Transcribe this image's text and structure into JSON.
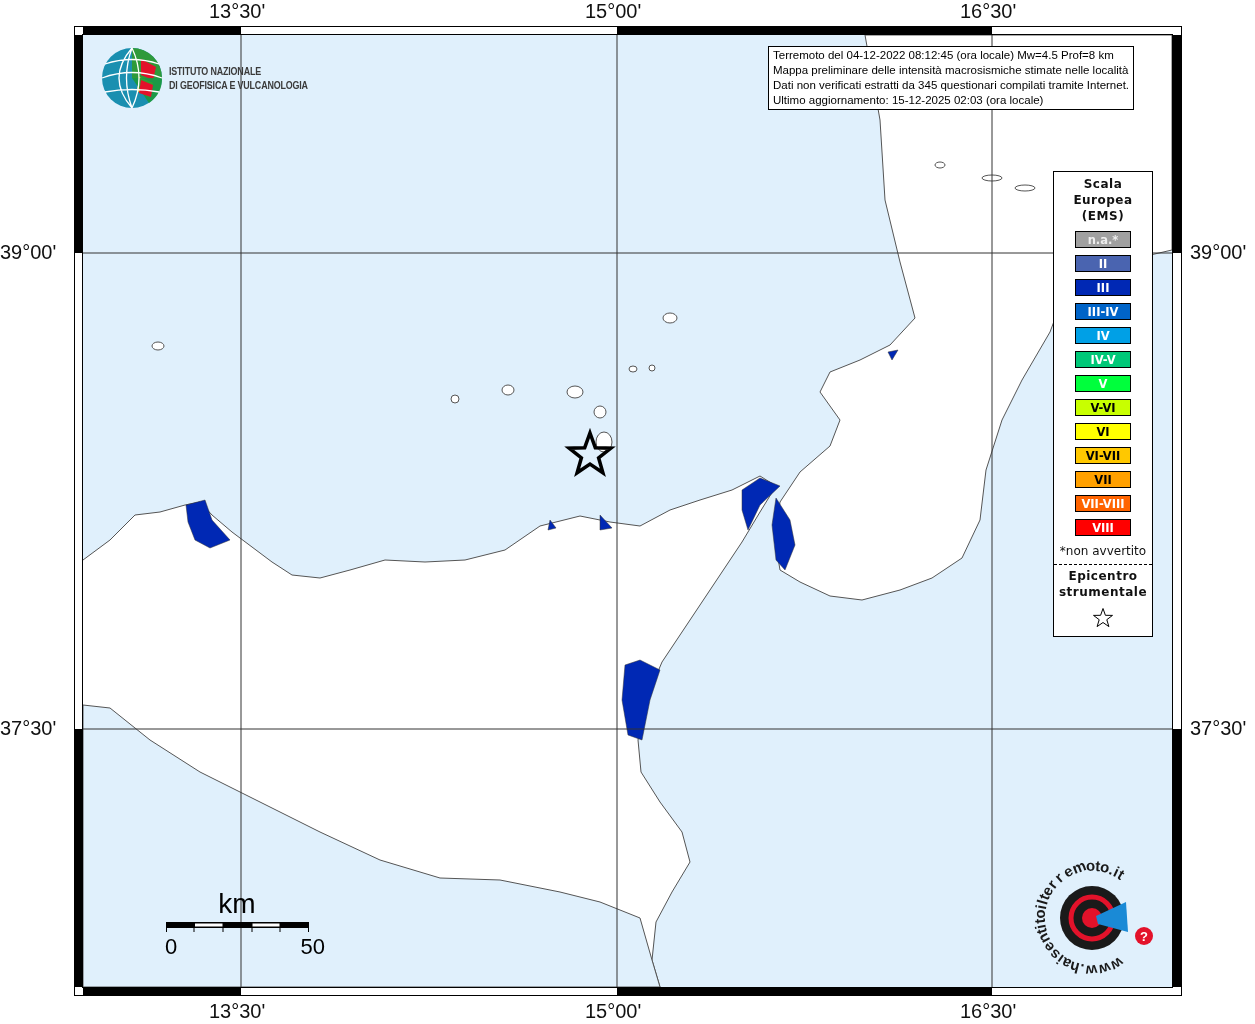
{
  "axes": {
    "top": [
      "13°30'",
      "15°00'",
      "16°30'"
    ],
    "bottom": [
      "13°30'",
      "15°00'",
      "16°30'"
    ],
    "left": [
      "39°00'",
      "37°30'"
    ],
    "right": [
      "39°00'",
      "37°30'"
    ]
  },
  "info_box": [
    "Terremoto del 04-12-2022 08:12:45 (ora locale) Mw=4.5 Prof=8 km",
    "Mappa preliminare delle intensità macrosismiche stimate nelle località",
    "Dati non verificati estratti da 345 questionari compilati tramite Internet.",
    "Ultimo aggiornamento: 15-12-2025 02:03 (ora locale)"
  ],
  "institute_logo": {
    "lines": [
      "ISTITUTO NAZIONALE",
      "DI GEOFISICA E VULCANOLOGIA"
    ]
  },
  "legend": {
    "title": [
      "Scala",
      "Europea",
      "(EMS)"
    ],
    "items": [
      {
        "label": "n.a.*",
        "color": "#a0a0a0"
      },
      {
        "label": "II",
        "color": "#4a64b0"
      },
      {
        "label": "III",
        "color": "#0028b4"
      },
      {
        "label": "III-IV",
        "color": "#0064c8"
      },
      {
        "label": "IV",
        "color": "#00a0e6"
      },
      {
        "label": "IV-V",
        "color": "#00c878"
      },
      {
        "label": "V",
        "color": "#00ff3c"
      },
      {
        "label": "V-VI",
        "color": "#c8ff00"
      },
      {
        "label": "VI",
        "color": "#ffff00"
      },
      {
        "label": "VI-VII",
        "color": "#ffc800"
      },
      {
        "label": "VII",
        "color": "#ffa000"
      },
      {
        "label": "VII-VIII",
        "color": "#ff6400"
      },
      {
        "label": "VIII",
        "color": "#ff0000"
      }
    ],
    "footnote": "*non avvertito",
    "epicentre_label": [
      "Epicentro",
      "strumentale"
    ]
  },
  "scale_bar": {
    "unit": "km",
    "start": "0",
    "end": "50"
  },
  "site_logo": {
    "ring_text": "www.haisentitoilterremoto.it",
    "badge": "?"
  }
}
